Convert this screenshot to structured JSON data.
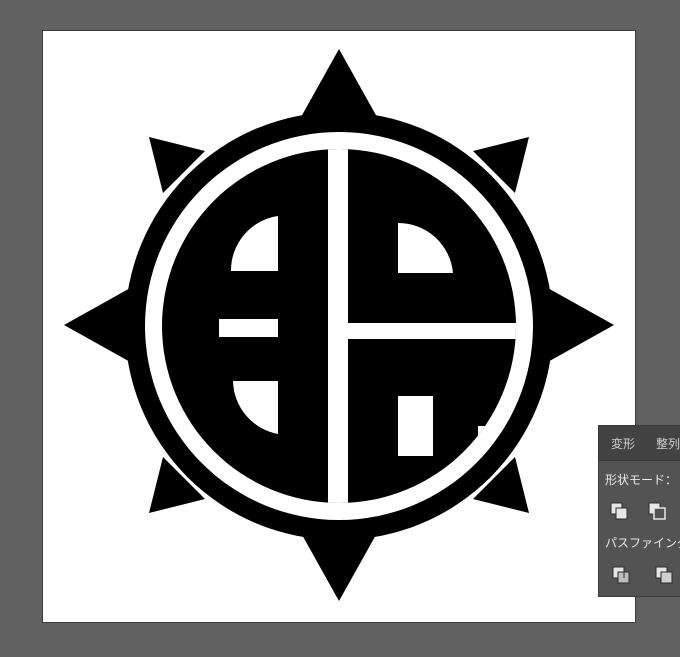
{
  "panel": {
    "tabs": [
      {
        "label": "変形"
      },
      {
        "label": "整列"
      }
    ],
    "shape_mode_label": "形状モード：",
    "pathfinder_label": "パスファインダー：",
    "shape_mode_buttons": [
      {
        "icon": "unite-icon"
      },
      {
        "icon": "minus-front-icon"
      }
    ],
    "pathfinder_buttons": [
      {
        "icon": "divide-icon"
      },
      {
        "icon": "trim-icon"
      }
    ]
  },
  "colors": {
    "workspace": "#616161",
    "artboard": "#ffffff",
    "emblem": "#000000",
    "panel_bg": "#535353",
    "panel_tab_bg": "#434343"
  }
}
